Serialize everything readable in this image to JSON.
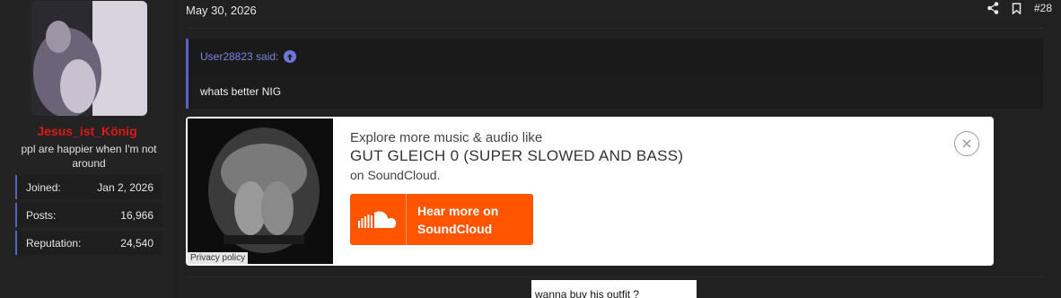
{
  "user": {
    "username": "Jesus_ist_König",
    "title": "ppl are happier when I'm not around",
    "stats": [
      {
        "label": "Joined:",
        "value": "Jan 2, 2026"
      },
      {
        "label": "Posts:",
        "value": "16,966"
      },
      {
        "label": "Reputation:",
        "value": "24,540"
      }
    ]
  },
  "post": {
    "date": "May 30, 2026",
    "number": "#28",
    "actions": {
      "share_icon": "share-icon",
      "bookmark_icon": "bookmark-icon"
    },
    "quote": {
      "author_line": "User28823 said:",
      "body": "whats better NIG"
    }
  },
  "soundcloud": {
    "explore_text": "Explore more music & audio like",
    "track_title": "GUT GLEICH 0 (SUPER SLOWED AND BASS)",
    "on_text": "on SoundCloud.",
    "button_line1": "Hear more on",
    "button_line2": "SoundCloud",
    "privacy": "Privacy policy",
    "brand_color": "#ff5500"
  },
  "next_post": {
    "preview_text": "wanna buy his outfit ?"
  },
  "colors": {
    "background": "#212121",
    "accent": "#5a63c4",
    "username": "#e01818"
  }
}
